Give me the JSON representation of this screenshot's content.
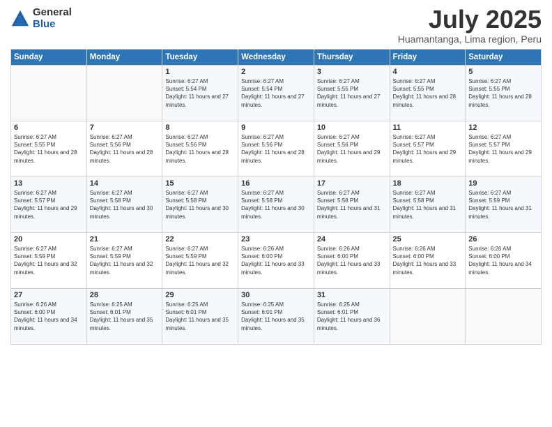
{
  "logo": {
    "general": "General",
    "blue": "Blue"
  },
  "header": {
    "title": "July 2025",
    "subtitle": "Huamantanga, Lima region, Peru"
  },
  "days_of_week": [
    "Sunday",
    "Monday",
    "Tuesday",
    "Wednesday",
    "Thursday",
    "Friday",
    "Saturday"
  ],
  "weeks": [
    [
      {
        "day": "",
        "info": ""
      },
      {
        "day": "",
        "info": ""
      },
      {
        "day": "1",
        "info": "Sunrise: 6:27 AM\nSunset: 5:54 PM\nDaylight: 11 hours and 27 minutes."
      },
      {
        "day": "2",
        "info": "Sunrise: 6:27 AM\nSunset: 5:54 PM\nDaylight: 11 hours and 27 minutes."
      },
      {
        "day": "3",
        "info": "Sunrise: 6:27 AM\nSunset: 5:55 PM\nDaylight: 11 hours and 27 minutes."
      },
      {
        "day": "4",
        "info": "Sunrise: 6:27 AM\nSunset: 5:55 PM\nDaylight: 11 hours and 28 minutes."
      },
      {
        "day": "5",
        "info": "Sunrise: 6:27 AM\nSunset: 5:55 PM\nDaylight: 11 hours and 28 minutes."
      }
    ],
    [
      {
        "day": "6",
        "info": "Sunrise: 6:27 AM\nSunset: 5:55 PM\nDaylight: 11 hours and 28 minutes."
      },
      {
        "day": "7",
        "info": "Sunrise: 6:27 AM\nSunset: 5:56 PM\nDaylight: 11 hours and 28 minutes."
      },
      {
        "day": "8",
        "info": "Sunrise: 6:27 AM\nSunset: 5:56 PM\nDaylight: 11 hours and 28 minutes."
      },
      {
        "day": "9",
        "info": "Sunrise: 6:27 AM\nSunset: 5:56 PM\nDaylight: 11 hours and 28 minutes."
      },
      {
        "day": "10",
        "info": "Sunrise: 6:27 AM\nSunset: 5:56 PM\nDaylight: 11 hours and 29 minutes."
      },
      {
        "day": "11",
        "info": "Sunrise: 6:27 AM\nSunset: 5:57 PM\nDaylight: 11 hours and 29 minutes."
      },
      {
        "day": "12",
        "info": "Sunrise: 6:27 AM\nSunset: 5:57 PM\nDaylight: 11 hours and 29 minutes."
      }
    ],
    [
      {
        "day": "13",
        "info": "Sunrise: 6:27 AM\nSunset: 5:57 PM\nDaylight: 11 hours and 29 minutes."
      },
      {
        "day": "14",
        "info": "Sunrise: 6:27 AM\nSunset: 5:58 PM\nDaylight: 11 hours and 30 minutes."
      },
      {
        "day": "15",
        "info": "Sunrise: 6:27 AM\nSunset: 5:58 PM\nDaylight: 11 hours and 30 minutes."
      },
      {
        "day": "16",
        "info": "Sunrise: 6:27 AM\nSunset: 5:58 PM\nDaylight: 11 hours and 30 minutes."
      },
      {
        "day": "17",
        "info": "Sunrise: 6:27 AM\nSunset: 5:58 PM\nDaylight: 11 hours and 31 minutes."
      },
      {
        "day": "18",
        "info": "Sunrise: 6:27 AM\nSunset: 5:58 PM\nDaylight: 11 hours and 31 minutes."
      },
      {
        "day": "19",
        "info": "Sunrise: 6:27 AM\nSunset: 5:59 PM\nDaylight: 11 hours and 31 minutes."
      }
    ],
    [
      {
        "day": "20",
        "info": "Sunrise: 6:27 AM\nSunset: 5:59 PM\nDaylight: 11 hours and 32 minutes."
      },
      {
        "day": "21",
        "info": "Sunrise: 6:27 AM\nSunset: 5:59 PM\nDaylight: 11 hours and 32 minutes."
      },
      {
        "day": "22",
        "info": "Sunrise: 6:27 AM\nSunset: 5:59 PM\nDaylight: 11 hours and 32 minutes."
      },
      {
        "day": "23",
        "info": "Sunrise: 6:26 AM\nSunset: 6:00 PM\nDaylight: 11 hours and 33 minutes."
      },
      {
        "day": "24",
        "info": "Sunrise: 6:26 AM\nSunset: 6:00 PM\nDaylight: 11 hours and 33 minutes."
      },
      {
        "day": "25",
        "info": "Sunrise: 6:26 AM\nSunset: 6:00 PM\nDaylight: 11 hours and 33 minutes."
      },
      {
        "day": "26",
        "info": "Sunrise: 6:26 AM\nSunset: 6:00 PM\nDaylight: 11 hours and 34 minutes."
      }
    ],
    [
      {
        "day": "27",
        "info": "Sunrise: 6:26 AM\nSunset: 6:00 PM\nDaylight: 11 hours and 34 minutes."
      },
      {
        "day": "28",
        "info": "Sunrise: 6:25 AM\nSunset: 6:01 PM\nDaylight: 11 hours and 35 minutes."
      },
      {
        "day": "29",
        "info": "Sunrise: 6:25 AM\nSunset: 6:01 PM\nDaylight: 11 hours and 35 minutes."
      },
      {
        "day": "30",
        "info": "Sunrise: 6:25 AM\nSunset: 6:01 PM\nDaylight: 11 hours and 35 minutes."
      },
      {
        "day": "31",
        "info": "Sunrise: 6:25 AM\nSunset: 6:01 PM\nDaylight: 11 hours and 36 minutes."
      },
      {
        "day": "",
        "info": ""
      },
      {
        "day": "",
        "info": ""
      }
    ]
  ]
}
